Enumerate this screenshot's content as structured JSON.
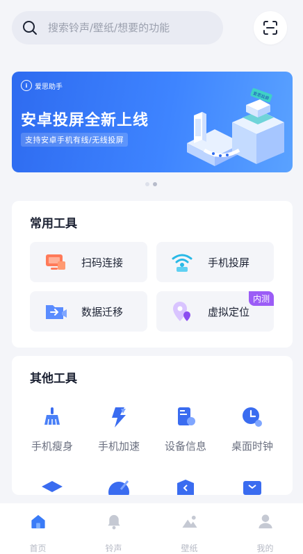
{
  "search": {
    "placeholder": "搜索铃声/壁纸/想要的功能"
  },
  "banner": {
    "brand": "爱思助手",
    "title": "安卓投屏全新上线",
    "subtitle": "支持安卓手机有线/无线投屏",
    "art_tag": "爱思投屏",
    "page_index": 2,
    "page_count": 2
  },
  "common_tools": {
    "title": "常用工具",
    "items": [
      {
        "label": "扫码连接",
        "icon": "scan-connect-icon"
      },
      {
        "label": "手机投屏",
        "icon": "phone-cast-icon"
      },
      {
        "label": "数据迁移",
        "icon": "data-migrate-icon"
      },
      {
        "label": "虚拟定位",
        "icon": "virtual-location-icon",
        "badge": "内测"
      }
    ]
  },
  "other_tools": {
    "title": "其他工具",
    "items": [
      {
        "label": "手机瘦身",
        "icon": "broom-icon"
      },
      {
        "label": "手机加速",
        "icon": "lightning-icon"
      },
      {
        "label": "设备信息",
        "icon": "device-info-icon"
      },
      {
        "label": "桌面时钟",
        "icon": "clock-icon"
      }
    ]
  },
  "bottom_nav": [
    {
      "label": "首页",
      "icon": "home-icon",
      "active": true
    },
    {
      "label": "铃声",
      "icon": "bell-icon"
    },
    {
      "label": "壁纸",
      "icon": "wallpaper-icon"
    },
    {
      "label": "我的",
      "icon": "user-icon"
    }
  ],
  "colors": {
    "accent": "#3a7bf7",
    "badge": "#9b5cf6",
    "background": "#f4f5f9"
  }
}
